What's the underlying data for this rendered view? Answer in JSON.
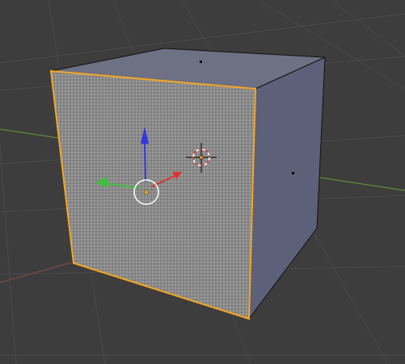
{
  "viewport": {
    "background_color": "#3d3d3d",
    "grid_line_color": "#4a4a4a",
    "x_axis_color": "#6b9a3a",
    "y_axis_color": "#8a4a4a"
  },
  "object": {
    "type": "cube",
    "selected": true,
    "edit_mode": true,
    "selected_face": "front",
    "front_face_color": "#8c8c8c",
    "top_face_color": "#6e7184",
    "side_face_color": "#5d6079",
    "outline_color": "#f5a623",
    "face_dot_color": "#000000"
  },
  "manipulator": {
    "icon": "translate-manipulator-icon",
    "x_axis_color": "#e03131",
    "y_axis_color": "#3fbf3f",
    "z_axis_color": "#3535e0",
    "center_ring_color": "#ffffff",
    "origin_color": "#f5a623"
  },
  "cursor_3d": {
    "icon": "3d-cursor-icon",
    "ring_colors": [
      "#ffffff",
      "#e03131"
    ],
    "crosshair_color": "#000000"
  }
}
